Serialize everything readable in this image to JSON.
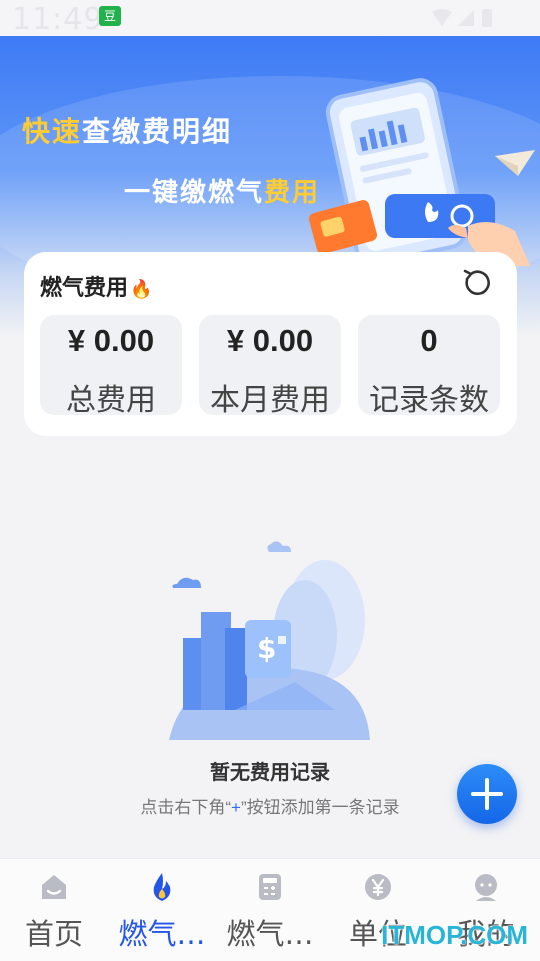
{
  "status_bar": {
    "time": "11:49",
    "app_icon_label": "豆"
  },
  "banner": {
    "line1_highlight": "快速",
    "line1_rest": "查缴费明细",
    "line2_rest": "一键缴燃气",
    "line2_highlight": "费用"
  },
  "stats_card": {
    "title": "燃气费用",
    "flame_icon": "🔥",
    "stats": [
      {
        "value": "¥ 0.00",
        "label": "总费用"
      },
      {
        "value": "¥ 0.00",
        "label": "本月费用"
      },
      {
        "value": "0",
        "label": "记录条数"
      }
    ]
  },
  "empty_state": {
    "title": "暂无费用记录",
    "hint_prefix": "点击右下角“",
    "hint_plus": "+",
    "hint_suffix": "”按钮添加第一条记录"
  },
  "bottom_nav": {
    "items": [
      {
        "label": "首页",
        "icon": "home-icon",
        "active": false
      },
      {
        "label": "燃气…",
        "icon": "flame-icon",
        "active": true
      },
      {
        "label": "燃气…",
        "icon": "calculator-icon",
        "active": false
      },
      {
        "label": "单位",
        "icon": "yen-icon",
        "active": false
      },
      {
        "label": "我的",
        "icon": "profile-icon",
        "active": false
      }
    ]
  },
  "watermark": "ITMOP.COM",
  "colors": {
    "accent": "#2356e8",
    "fab": "#1f78f0",
    "banner": "#3f7bf5",
    "highlight": "#ffcc33"
  }
}
